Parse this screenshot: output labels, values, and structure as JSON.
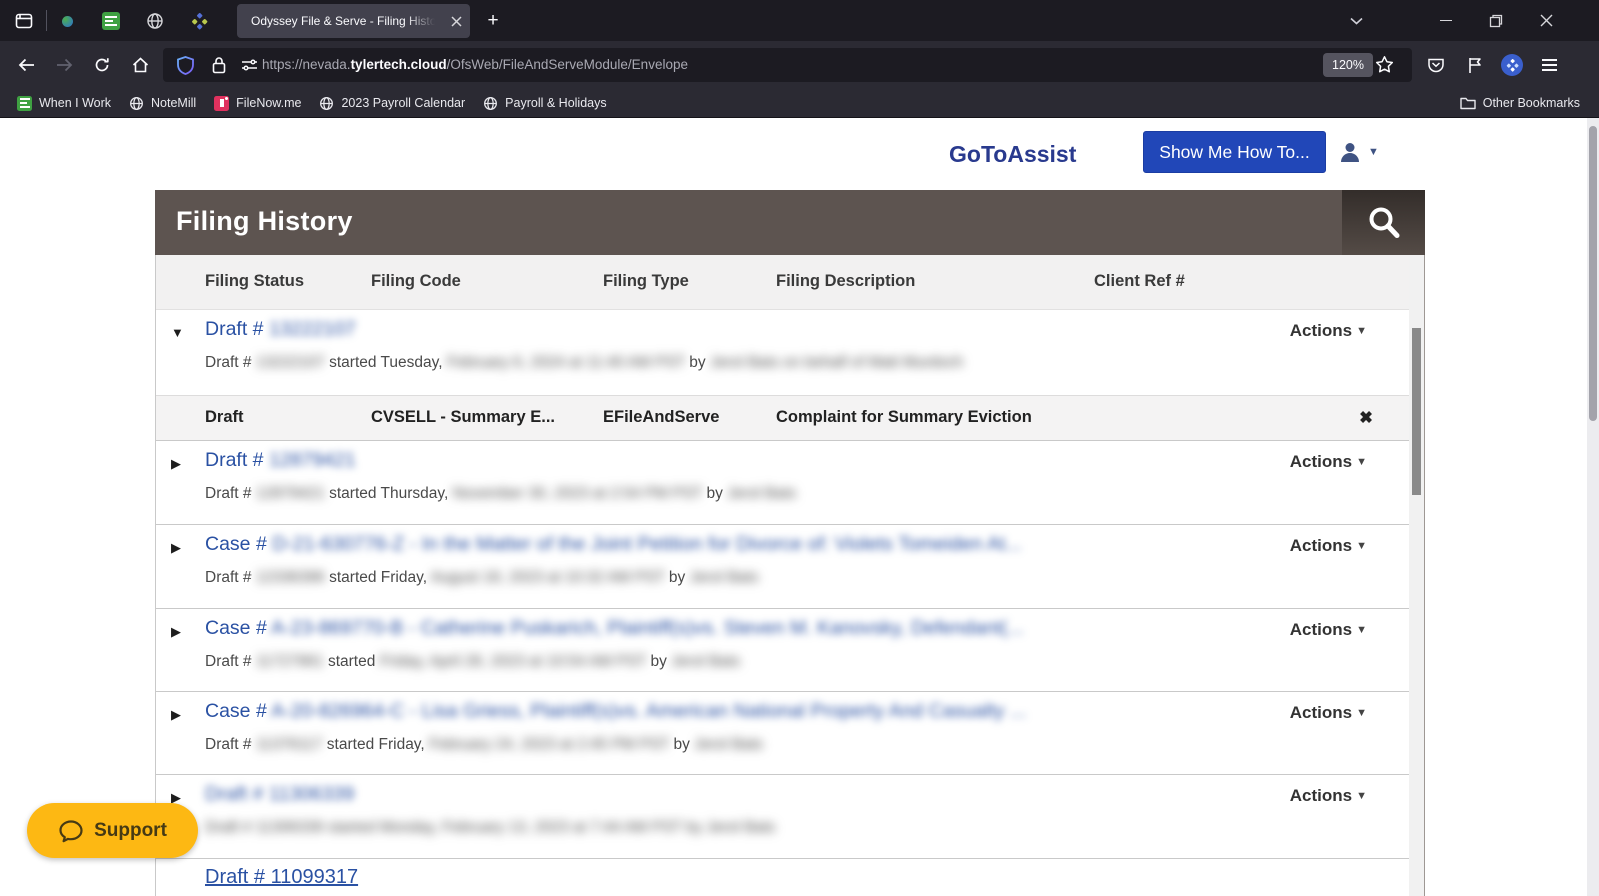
{
  "browser": {
    "tab": {
      "active_title": "Odyssey File & Serve - Filing History",
      "new_tab": "+"
    },
    "url": {
      "prefix": "https://nevada.",
      "domain": "tylertech.cloud",
      "path": "/OfsWeb/FileAndServeModule/Envelope"
    },
    "zoom_badge": "120%",
    "bookmarks": {
      "items": [
        "When I Work",
        "NoteMill",
        "FileNow.me",
        "2023 Payroll Calendar",
        "Payroll & Holidays"
      ],
      "other": "Other Bookmarks"
    }
  },
  "site": {
    "brand": "GoToAssist",
    "show_me_button": "Show Me How To...",
    "panel_title": "Filing History",
    "columns": [
      "Filing Status",
      "Filing Code",
      "Filing Type",
      "Filing Description",
      "Client Ref #"
    ],
    "actions_label": "Actions",
    "detail_row": {
      "status": "Draft",
      "code": "CVSELL - Summary E...",
      "type": "EFileAndServe",
      "description": "Complaint for Summary Eviction",
      "close_glyph": "✖"
    },
    "rows": [
      {
        "link_prefix": "Draft # ",
        "link_redacted": "13222107",
        "sub_prefix": "Draft # ",
        "sub_redacted_id": "13222107",
        "sub_started": " started Tuesday, ",
        "sub_redacted_date": "February 6, 2024 at 11:40 AM PST",
        "sub_by": " by ",
        "sub_redacted_name": "Jerol Bats on behalf of Matt Murdoch"
      },
      {
        "link_prefix": "Draft # ",
        "link_redacted": "12879421",
        "sub_prefix": "Draft # ",
        "sub_redacted_id": "12879421",
        "sub_started": " started Thursday, ",
        "sub_redacted_date": "November 30, 2023 at 2:54 PM PST",
        "sub_by": " by ",
        "sub_redacted_name": "Jerol Bats"
      },
      {
        "link_prefix": "Case # ",
        "link_redacted": "D-21-630776-Z - In the Matter of the Joint Petition for Divorce of: Violets Tomeiden At...",
        "sub_prefix": "Draft # ",
        "sub_redacted_id": "12336396",
        "sub_started": " started Friday, ",
        "sub_redacted_date": "August 18, 2023 at 10:32 AM PST",
        "sub_by": " by ",
        "sub_redacted_name": "Jerol Bats"
      },
      {
        "link_prefix": "Case # ",
        "link_redacted": "A-23-869770-B - Catherine Puskarich, Plaintiff(s)vs. Steven M. Kanovsky, Defendant(...",
        "sub_prefix": "Draft # ",
        "sub_redacted_id": "11727961",
        "sub_started": " started ",
        "sub_redacted_date": "Friday, April 28, 2023 at 10:54 AM PST",
        "sub_by": " by ",
        "sub_redacted_name": "Jerol Bats"
      },
      {
        "link_prefix": "Case # ",
        "link_redacted": "A-20-826964-C - Lisa Griess, Plaintiff(s)vs. American National Property And Casualty ...",
        "sub_prefix": "Draft # ",
        "sub_redacted_id": "11376117",
        "sub_started": " started Friday, ",
        "sub_redacted_date": "February 24, 2023 at 2:45 PM PST",
        "sub_by": " by ",
        "sub_redacted_name": "Jerol Bats"
      },
      {
        "link_redacted_full": "Draft # 11306339",
        "sub_redacted_full": "Draft # 11306339 started Monday, February 13, 2023 at 7:44 AM PST by Jerol Bats"
      },
      {
        "link": "Draft # 11099317"
      }
    ],
    "support_label": "Support"
  }
}
